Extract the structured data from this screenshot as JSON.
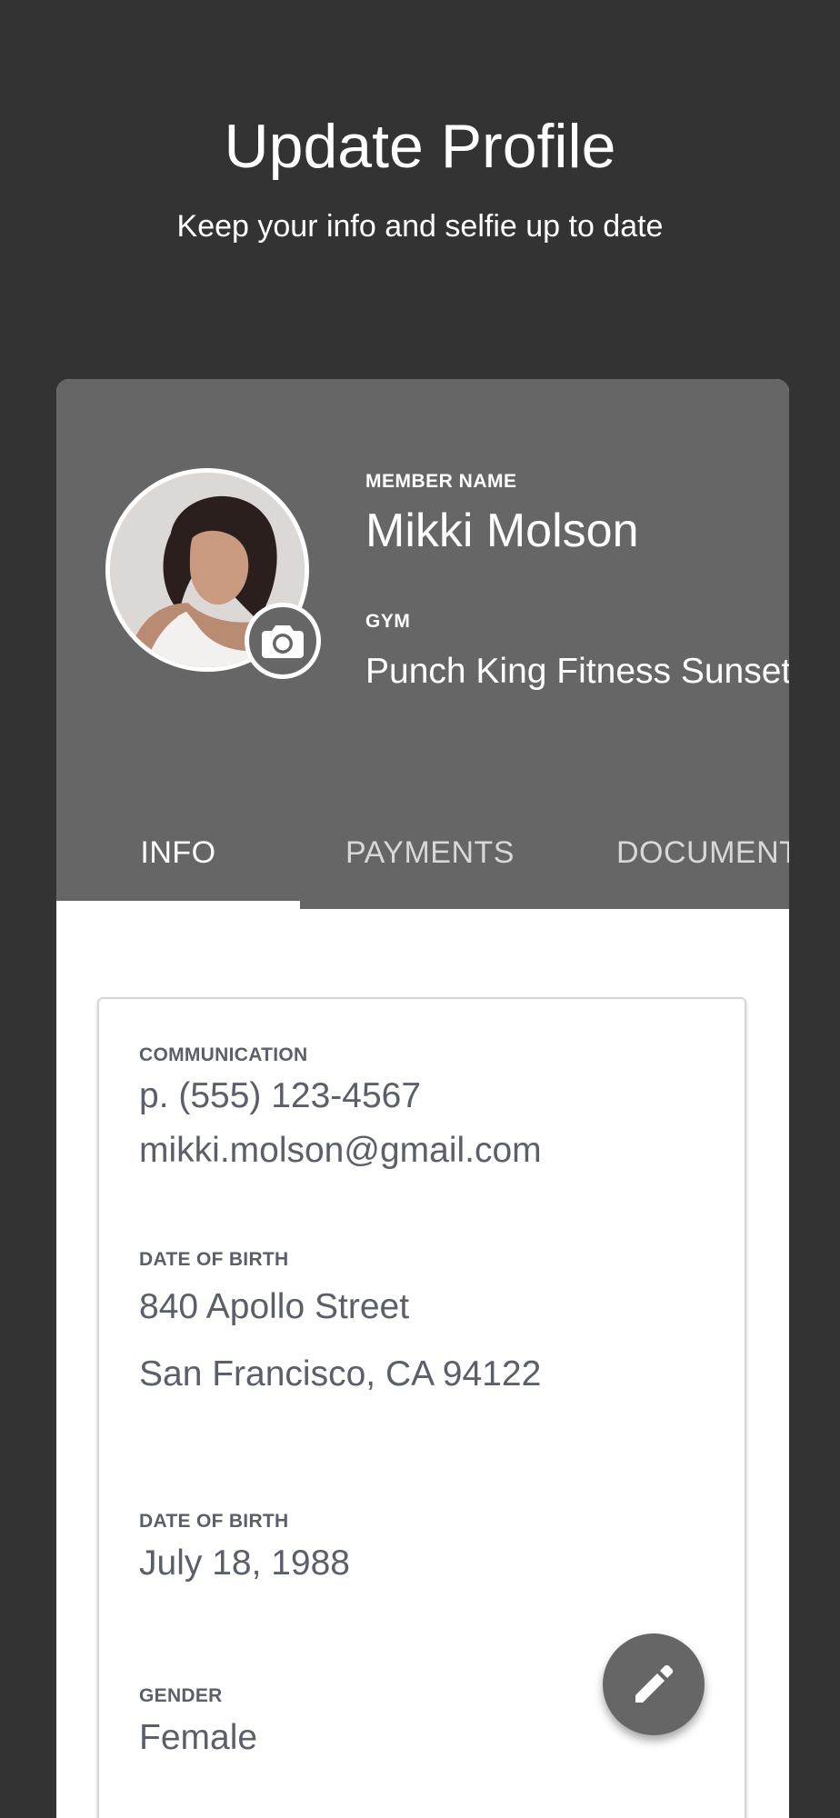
{
  "header": {
    "title": "Update Profile",
    "subtitle": "Keep your info and selfie up to date"
  },
  "profile": {
    "member_name_label": "MEMBER NAME",
    "member_name": "Mikki Molson",
    "gym_label": "GYM",
    "gym": "Punch King Fitness Sunset",
    "avatar_icon": "member-photo",
    "camera_icon": "camera-icon"
  },
  "tabs": [
    {
      "label": "INFO",
      "active": true
    },
    {
      "label": "PAYMENTS",
      "active": false
    },
    {
      "label": "DOCUMENTS",
      "active": false
    }
  ],
  "info": {
    "communication_label": "COMMUNICATION",
    "phone": "p. (555) 123-4567",
    "email": "mikki.molson@gmail.com",
    "address_label": "DATE OF BIRTH",
    "address_line1": "840 Apollo Street",
    "address_line2": "San Francisco, CA 94122",
    "dob_label": "DATE OF BIRTH",
    "dob": "July 18, 1988",
    "gender_label": "GENDER",
    "gender": "Female"
  },
  "fab": {
    "icon": "pencil-icon"
  },
  "colors": {
    "background": "#333333",
    "card_header": "#666666",
    "text_dark": "#5b5f6a",
    "white": "#ffffff"
  }
}
